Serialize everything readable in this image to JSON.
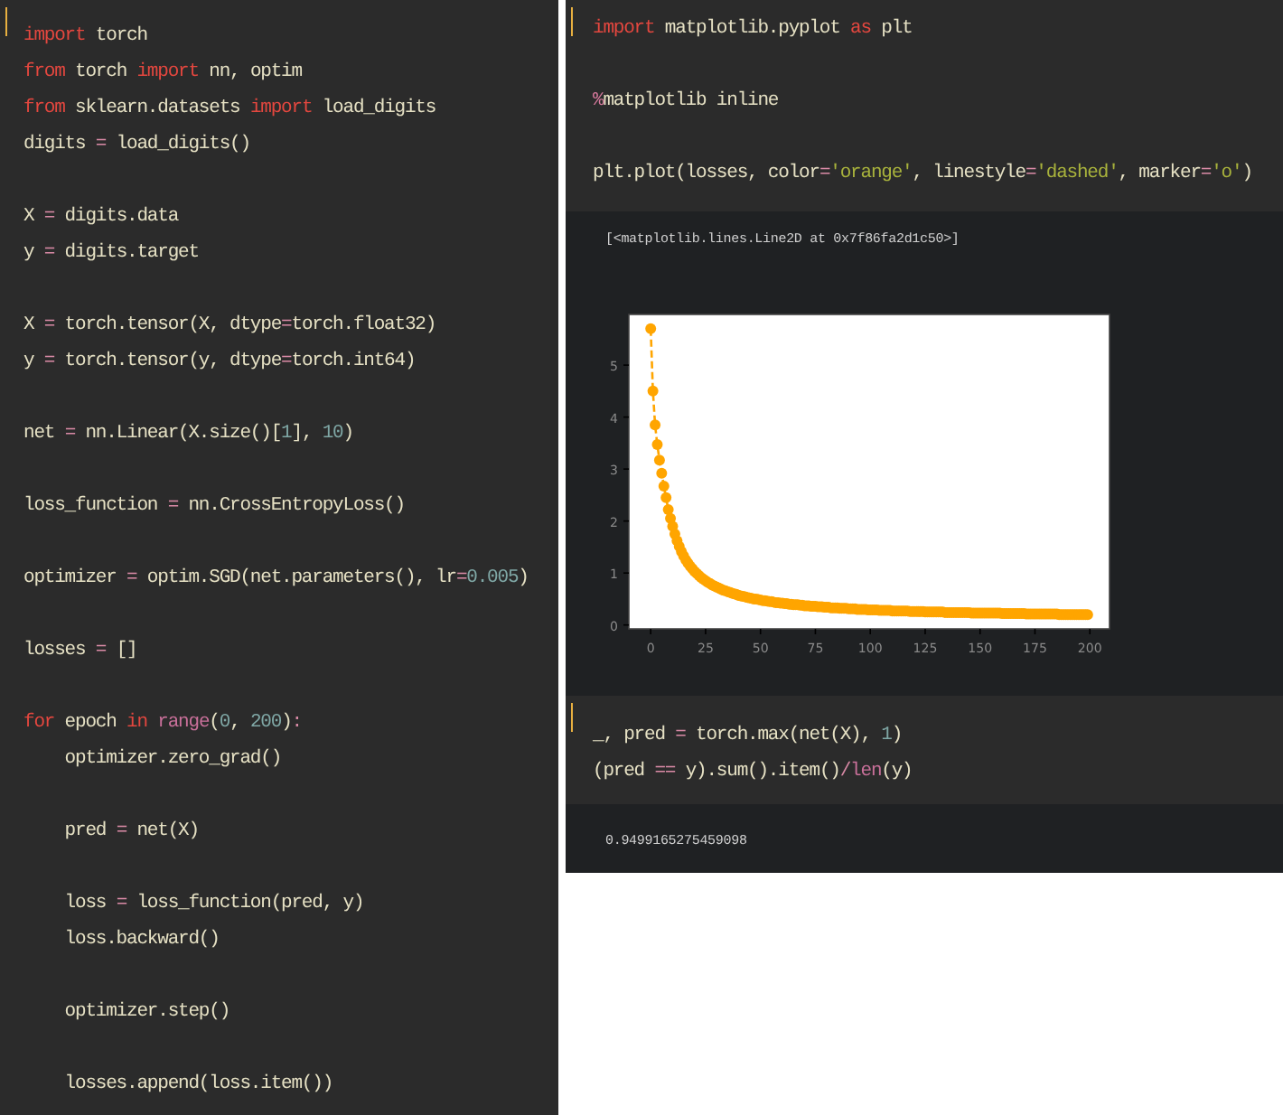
{
  "panels": [
    {
      "cells": [
        {
          "kind": "code",
          "active": true,
          "blocks": [
            [
              [
                {
                  "kind": "keyword",
                  "text": "import"
                },
                {
                  "kind": "plain",
                  "text": " torch"
                }
              ],
              [
                {
                  "kind": "keyword",
                  "text": "from"
                },
                {
                  "kind": "plain",
                  "text": " torch "
                },
                {
                  "kind": "keyword",
                  "text": "import"
                },
                {
                  "kind": "plain",
                  "text": " nn, optim"
                }
              ],
              [
                {
                  "kind": "keyword",
                  "text": "from"
                },
                {
                  "kind": "plain",
                  "text": " sklearn.datasets "
                },
                {
                  "kind": "keyword",
                  "text": "import"
                },
                {
                  "kind": "plain",
                  "text": " load_digits"
                }
              ],
              [
                {
                  "kind": "plain",
                  "text": "digits "
                },
                {
                  "kind": "operator",
                  "text": "="
                },
                {
                  "kind": "plain",
                  "text": " load_digits()"
                }
              ]
            ],
            [
              [
                {
                  "kind": "plain",
                  "text": "X "
                },
                {
                  "kind": "operator",
                  "text": "="
                },
                {
                  "kind": "plain",
                  "text": " digits.data"
                }
              ],
              [
                {
                  "kind": "plain",
                  "text": "y "
                },
                {
                  "kind": "operator",
                  "text": "="
                },
                {
                  "kind": "plain",
                  "text": " digits.target"
                }
              ]
            ],
            [
              [
                {
                  "kind": "plain",
                  "text": "X "
                },
                {
                  "kind": "operator",
                  "text": "="
                },
                {
                  "kind": "plain",
                  "text": " torch.tensor(X, dtype"
                },
                {
                  "kind": "operator",
                  "text": "="
                },
                {
                  "kind": "plain",
                  "text": "torch.float32)"
                }
              ],
              [
                {
                  "kind": "plain",
                  "text": "y "
                },
                {
                  "kind": "operator",
                  "text": "="
                },
                {
                  "kind": "plain",
                  "text": " torch.tensor(y, dtype"
                },
                {
                  "kind": "operator",
                  "text": "="
                },
                {
                  "kind": "plain",
                  "text": "torch.int64)"
                }
              ]
            ],
            [
              [
                {
                  "kind": "plain",
                  "text": "net "
                },
                {
                  "kind": "operator",
                  "text": "="
                },
                {
                  "kind": "plain",
                  "text": " nn.Linear(X.size()["
                },
                {
                  "kind": "number",
                  "text": "1"
                },
                {
                  "kind": "plain",
                  "text": "], "
                },
                {
                  "kind": "number",
                  "text": "10"
                },
                {
                  "kind": "plain",
                  "text": ")"
                }
              ]
            ],
            [
              [
                {
                  "kind": "plain",
                  "text": "loss_function "
                },
                {
                  "kind": "operator",
                  "text": "="
                },
                {
                  "kind": "plain",
                  "text": " nn.CrossEntropyLoss()"
                }
              ]
            ],
            [
              [
                {
                  "kind": "plain",
                  "text": "optimizer "
                },
                {
                  "kind": "operator",
                  "text": "="
                },
                {
                  "kind": "plain",
                  "text": " optim.SGD(net.parameters(), lr"
                },
                {
                  "kind": "operator",
                  "text": "="
                },
                {
                  "kind": "number",
                  "text": "0.005"
                },
                {
                  "kind": "plain",
                  "text": ")"
                }
              ]
            ],
            [
              [
                {
                  "kind": "plain",
                  "text": "losses "
                },
                {
                  "kind": "operator",
                  "text": "="
                },
                {
                  "kind": "plain",
                  "text": " []"
                }
              ]
            ],
            [
              [
                {
                  "kind": "keyword",
                  "text": "for"
                },
                {
                  "kind": "plain",
                  "text": " epoch "
                },
                {
                  "kind": "keyword",
                  "text": "in"
                },
                {
                  "kind": "builtin",
                  "text": " range"
                },
                {
                  "kind": "plain",
                  "text": "("
                },
                {
                  "kind": "number",
                  "text": "0"
                },
                {
                  "kind": "plain",
                  "text": ", "
                },
                {
                  "kind": "number",
                  "text": "200"
                },
                {
                  "kind": "plain",
                  "text": ")"
                },
                {
                  "kind": "operator",
                  "text": ":"
                }
              ],
              [
                {
                  "kind": "plain",
                  "text": "    optimizer.zero_grad()"
                }
              ]
            ],
            [
              [
                {
                  "kind": "plain",
                  "text": "    pred "
                },
                {
                  "kind": "operator",
                  "text": "="
                },
                {
                  "kind": "plain",
                  "text": " net(X)"
                }
              ]
            ],
            [
              [
                {
                  "kind": "plain",
                  "text": "    loss "
                },
                {
                  "kind": "operator",
                  "text": "="
                },
                {
                  "kind": "plain",
                  "text": " loss_function(pred, y)"
                }
              ],
              [
                {
                  "kind": "plain",
                  "text": "    loss.backward()"
                }
              ]
            ],
            [
              [
                {
                  "kind": "plain",
                  "text": "    optimizer.step()"
                }
              ]
            ],
            [
              [
                {
                  "kind": "plain",
                  "text": "    losses.append(loss.item())"
                }
              ]
            ]
          ]
        }
      ]
    },
    {
      "cells": [
        {
          "kind": "code",
          "active": true,
          "blocks": [
            [
              [
                {
                  "kind": "keyword",
                  "text": "import"
                },
                {
                  "kind": "plain",
                  "text": " matplotlib.pyplot "
                },
                {
                  "kind": "keyword",
                  "text": "as"
                },
                {
                  "kind": "plain",
                  "text": " plt"
                }
              ]
            ],
            [
              [
                {
                  "kind": "magic",
                  "text": "%"
                },
                {
                  "kind": "plain",
                  "text": "matplotlib inline"
                }
              ]
            ],
            [
              [
                {
                  "kind": "plain",
                  "text": "plt.plot(losses, color"
                },
                {
                  "kind": "operator",
                  "text": "="
                },
                {
                  "kind": "string",
                  "text": "'orange'"
                },
                {
                  "kind": "plain",
                  "text": ", linestyle"
                },
                {
                  "kind": "operator",
                  "text": "="
                },
                {
                  "kind": "string",
                  "text": "'dashed'"
                },
                {
                  "kind": "plain",
                  "text": ", marker"
                },
                {
                  "kind": "operator",
                  "text": "="
                },
                {
                  "kind": "string",
                  "text": "'o'"
                },
                {
                  "kind": "plain",
                  "text": ")"
                }
              ]
            ]
          ]
        },
        {
          "kind": "output",
          "text": "[<matplotlib.lines.Line2D at 0x7f86fa2d1c50>]",
          "chart_data": {
            "type": "line",
            "xlim": [
              -9.95,
              208.95
            ],
            "ylim": [
              -0.075,
              5.975
            ],
            "xticks": [
              0,
              25,
              50,
              75,
              100,
              125,
              150,
              175,
              200
            ],
            "yticks": [
              0,
              1,
              2,
              3,
              4,
              5
            ],
            "x": [
              0,
              1,
              2,
              3,
              4,
              5,
              6,
              7,
              8,
              9,
              10,
              11,
              12,
              13,
              14,
              15,
              16,
              17,
              18,
              19,
              20,
              21,
              22,
              23,
              24,
              25,
              26,
              27,
              28,
              29,
              30,
              31,
              32,
              33,
              34,
              35,
              36,
              37,
              38,
              39,
              40,
              41,
              42,
              43,
              44,
              45,
              46,
              47,
              48,
              49,
              50,
              51,
              52,
              53,
              54,
              55,
              56,
              57,
              58,
              59,
              60,
              61,
              62,
              63,
              64,
              65,
              66,
              67,
              68,
              69,
              70,
              71,
              72,
              73,
              74,
              75,
              76,
              77,
              78,
              79,
              80,
              81,
              82,
              83,
              84,
              85,
              86,
              87,
              88,
              89,
              90,
              91,
              92,
              93,
              94,
              95,
              96,
              97,
              98,
              99,
              100,
              101,
              102,
              103,
              104,
              105,
              106,
              107,
              108,
              109,
              110,
              111,
              112,
              113,
              114,
              115,
              116,
              117,
              118,
              119,
              120,
              121,
              122,
              123,
              124,
              125,
              126,
              127,
              128,
              129,
              130,
              131,
              132,
              133,
              134,
              135,
              136,
              137,
              138,
              139,
              140,
              141,
              142,
              143,
              144,
              145,
              146,
              147,
              148,
              149,
              150,
              151,
              152,
              153,
              154,
              155,
              156,
              157,
              158,
              159,
              160,
              161,
              162,
              163,
              164,
              165,
              166,
              167,
              168,
              169,
              170,
              171,
              172,
              173,
              174,
              175,
              176,
              177,
              178,
              179,
              180,
              181,
              182,
              183,
              184,
              185,
              186,
              187,
              188,
              189,
              190,
              191,
              192,
              193,
              194,
              195,
              196,
              197,
              198,
              199
            ],
            "series": [
              {
                "color": "#ffa500",
                "line_style": "dashed",
                "marker": "o",
                "values": [
                  5.7,
                  4.5,
                  3.85,
                  3.47,
                  3.17,
                  2.92,
                  2.67,
                  2.45,
                  2.22,
                  2.05,
                  1.9,
                  1.75,
                  1.62,
                  1.51,
                  1.41,
                  1.33,
                  1.25,
                  1.19,
                  1.13,
                  1.08,
                  1.03,
                  0.99,
                  0.95,
                  0.91,
                  0.88,
                  0.85,
                  0.82,
                  0.8,
                  0.77,
                  0.75,
                  0.73,
                  0.71,
                  0.69,
                  0.67,
                  0.66,
                  0.64,
                  0.63,
                  0.61,
                  0.6,
                  0.59,
                  0.57,
                  0.56,
                  0.55,
                  0.54,
                  0.53,
                  0.52,
                  0.51,
                  0.5,
                  0.5,
                  0.49,
                  0.48,
                  0.47,
                  0.47,
                  0.46,
                  0.45,
                  0.45,
                  0.44,
                  0.43,
                  0.43,
                  0.42,
                  0.42,
                  0.41,
                  0.41,
                  0.4,
                  0.4,
                  0.39,
                  0.39,
                  0.39,
                  0.38,
                  0.38,
                  0.37,
                  0.37,
                  0.37,
                  0.36,
                  0.36,
                  0.36,
                  0.35,
                  0.35,
                  0.35,
                  0.34,
                  0.34,
                  0.34,
                  0.33,
                  0.33,
                  0.33,
                  0.33,
                  0.32,
                  0.32,
                  0.32,
                  0.32,
                  0.31,
                  0.31,
                  0.31,
                  0.31,
                  0.3,
                  0.3,
                  0.3,
                  0.3,
                  0.3,
                  0.29,
                  0.29,
                  0.29,
                  0.29,
                  0.29,
                  0.28,
                  0.28,
                  0.28,
                  0.28,
                  0.28,
                  0.28,
                  0.27,
                  0.27,
                  0.27,
                  0.27,
                  0.27,
                  0.27,
                  0.27,
                  0.27,
                  0.26,
                  0.26,
                  0.26,
                  0.26,
                  0.26,
                  0.26,
                  0.26,
                  0.25,
                  0.25,
                  0.25,
                  0.25,
                  0.25,
                  0.25,
                  0.25,
                  0.25,
                  0.25,
                  0.24,
                  0.24,
                  0.24,
                  0.24,
                  0.24,
                  0.24,
                  0.24,
                  0.24,
                  0.24,
                  0.24,
                  0.24,
                  0.24,
                  0.23,
                  0.23,
                  0.23,
                  0.23,
                  0.23,
                  0.23,
                  0.23,
                  0.23,
                  0.23,
                  0.23,
                  0.23,
                  0.23,
                  0.23,
                  0.23,
                  0.22,
                  0.22,
                  0.22,
                  0.22,
                  0.22,
                  0.22,
                  0.22,
                  0.22,
                  0.22,
                  0.22,
                  0.22,
                  0.21,
                  0.21,
                  0.21,
                  0.21,
                  0.21,
                  0.21,
                  0.21,
                  0.21,
                  0.21,
                  0.21,
                  0.21,
                  0.21,
                  0.21,
                  0.21,
                  0.21,
                  0.2,
                  0.2,
                  0.2,
                  0.2,
                  0.2,
                  0.2,
                  0.2,
                  0.2,
                  0.2,
                  0.2,
                  0.2,
                  0.2,
                  0.2,
                  0.2
                ]
              }
            ]
          }
        },
        {
          "kind": "code",
          "active": true,
          "blocks": [
            [
              [
                {
                  "kind": "plain",
                  "text": "_, pred "
                },
                {
                  "kind": "operator",
                  "text": "="
                },
                {
                  "kind": "plain",
                  "text": " torch.max(net(X), "
                },
                {
                  "kind": "number",
                  "text": "1"
                },
                {
                  "kind": "plain",
                  "text": ")"
                }
              ],
              [
                {
                  "kind": "plain",
                  "text": "(pred "
                },
                {
                  "kind": "operator",
                  "text": "=="
                },
                {
                  "kind": "plain",
                  "text": " y).sum().item()"
                },
                {
                  "kind": "operator",
                  "text": "/"
                },
                {
                  "kind": "builtin",
                  "text": "len"
                },
                {
                  "kind": "plain",
                  "text": "(y)"
                }
              ]
            ]
          ]
        },
        {
          "kind": "output",
          "text": "0.9499165275459098"
        }
      ]
    }
  ]
}
